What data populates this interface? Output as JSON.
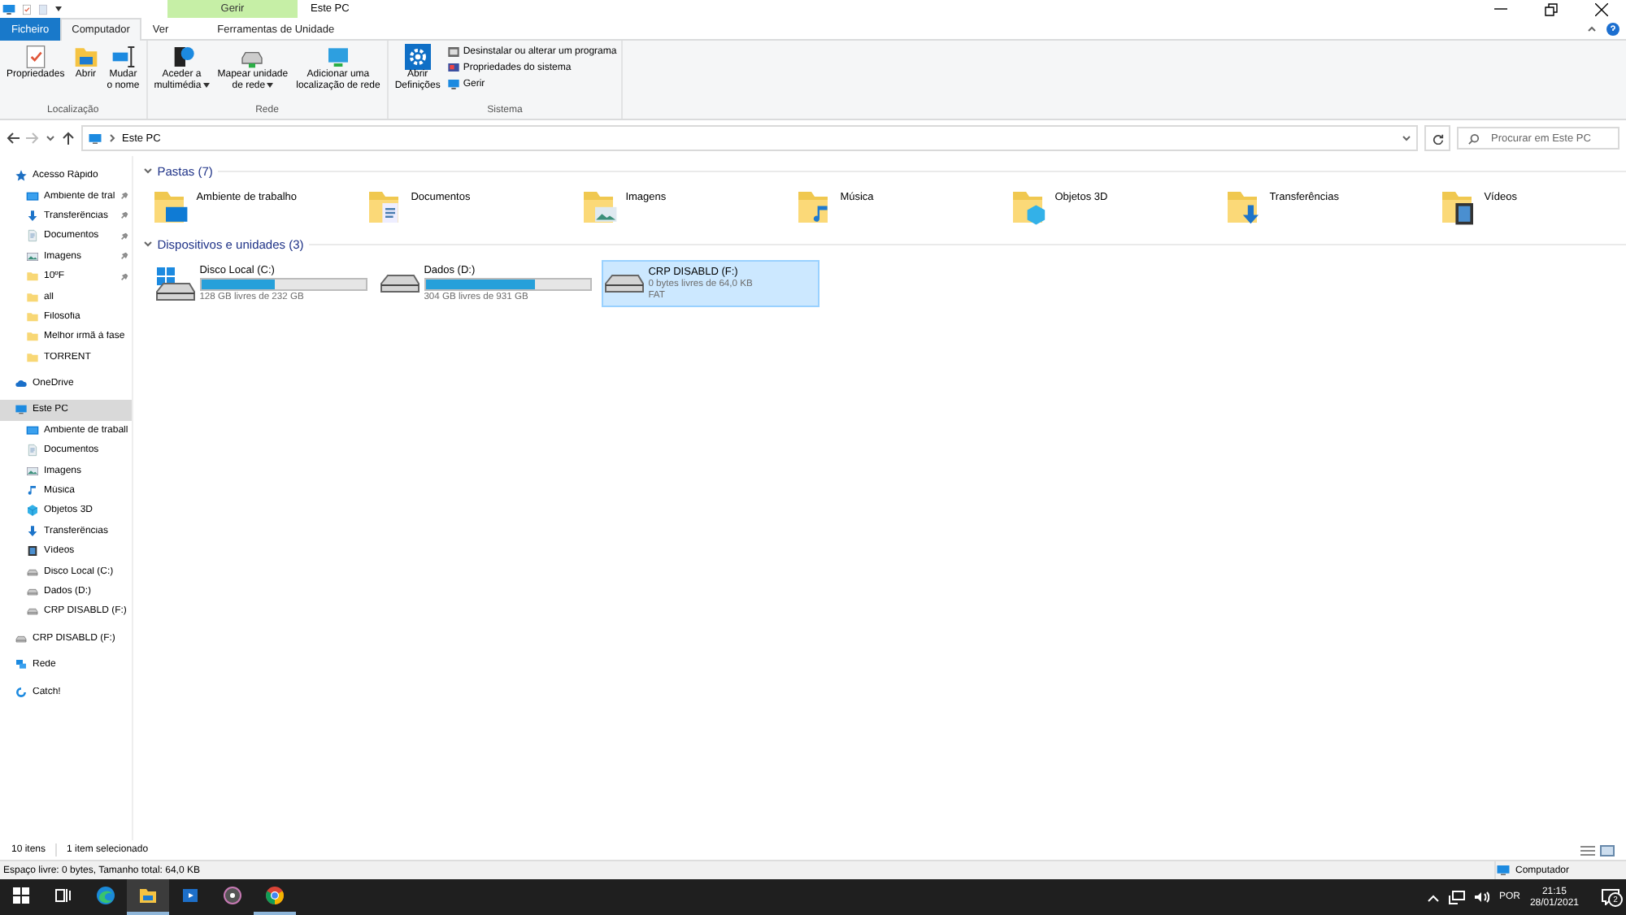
{
  "window": {
    "title": "Este PC",
    "context_header": "Gerir"
  },
  "ribbon": {
    "tabs": [
      {
        "label": "Ficheiro",
        "kind": "file",
        "selected": false
      },
      {
        "label": "Computador",
        "kind": "normal",
        "selected": true
      },
      {
        "label": "Ver",
        "kind": "normal",
        "selected": false
      },
      {
        "label": "Ferramentas de Unidade",
        "kind": "context",
        "selected": false
      }
    ],
    "groups": [
      {
        "label": "Localização",
        "buttons": [
          {
            "kind": "large",
            "lines": [
              "Propriedades"
            ],
            "dropdown": false
          },
          {
            "kind": "large",
            "lines": [
              "Abrir"
            ],
            "dropdown": false
          },
          {
            "kind": "large",
            "lines": [
              "Mudar",
              "o nome"
            ],
            "dropdown": false
          }
        ]
      },
      {
        "label": "Rede",
        "buttons": [
          {
            "kind": "large",
            "lines": [
              "Aceder a",
              "multimédia"
            ],
            "dropdown": true
          },
          {
            "kind": "large",
            "lines": [
              "Mapear unidade",
              "de rede"
            ],
            "dropdown": true
          },
          {
            "kind": "large",
            "lines": [
              "Adicionar uma",
              "localização de rede"
            ],
            "dropdown": false
          }
        ]
      },
      {
        "label": "Sistema",
        "buttons": [
          {
            "kind": "large",
            "lines": [
              "Abrir",
              "Definições"
            ],
            "dropdown": false
          },
          {
            "kind": "small",
            "lines": [
              "Desinstalar ou alterar um programa"
            ],
            "dropdown": false
          },
          {
            "kind": "small",
            "lines": [
              "Propriedades do sistema"
            ],
            "dropdown": false
          },
          {
            "kind": "small",
            "lines": [
              "Gerir"
            ],
            "dropdown": false
          }
        ]
      }
    ]
  },
  "address": {
    "path": "Este PC",
    "search_placeholder": "Procurar em Este PC"
  },
  "navigation": [
    {
      "label": "Acesso Rápido",
      "kind": "star",
      "selected": false,
      "pinned": false,
      "children": [
        {
          "label": "Ambiente de tral",
          "kind": "desktop",
          "selected": false,
          "pinned": true
        },
        {
          "label": "Transferências",
          "kind": "downloads",
          "selected": false,
          "pinned": true
        },
        {
          "label": "Documentos",
          "kind": "documents",
          "selected": false,
          "pinned": true
        },
        {
          "label": "Imagens",
          "kind": "pictures",
          "selected": false,
          "pinned": true
        },
        {
          "label": "10ºF",
          "kind": "folder",
          "selected": false,
          "pinned": true
        },
        {
          "label": "all",
          "kind": "folder",
          "selected": false,
          "pinned": false
        },
        {
          "label": "Filosofia",
          "kind": "folder",
          "selected": false,
          "pinned": false
        },
        {
          "label": "Melhor irmã à fase",
          "kind": "folder",
          "selected": false,
          "pinned": false
        },
        {
          "label": "TORRENT",
          "kind": "folder",
          "selected": false,
          "pinned": false
        }
      ]
    },
    {
      "label": "OneDrive",
      "kind": "cloud",
      "selected": false,
      "pinned": false
    },
    {
      "label": "Este PC",
      "kind": "pc",
      "selected": true,
      "pinned": false,
      "children": [
        {
          "label": "Ambiente de traball",
          "kind": "desktop",
          "selected": false,
          "pinned": false
        },
        {
          "label": "Documentos",
          "kind": "documents",
          "selected": false,
          "pinned": false
        },
        {
          "label": "Imagens",
          "kind": "pictures",
          "selected": false,
          "pinned": false
        },
        {
          "label": "Música",
          "kind": "music",
          "selected": false,
          "pinned": false
        },
        {
          "label": "Objetos 3D",
          "kind": "objects3d",
          "selected": false,
          "pinned": false
        },
        {
          "label": "Transferências",
          "kind": "downloads",
          "selected": false,
          "pinned": false
        },
        {
          "label": "Vídeos",
          "kind": "videos",
          "selected": false,
          "pinned": false
        },
        {
          "label": "Disco Local (C:)",
          "kind": "drive",
          "selected": false,
          "pinned": false
        },
        {
          "label": "Dados (D:)",
          "kind": "drive",
          "selected": false,
          "pinned": false
        },
        {
          "label": "CRP DISABLD (F:)",
          "kind": "drive",
          "selected": false,
          "pinned": false
        }
      ]
    },
    {
      "label": "CRP DISABLD (F:)",
      "kind": "drive",
      "selected": false,
      "pinned": false
    },
    {
      "label": "Rede",
      "kind": "network",
      "selected": false,
      "pinned": false
    },
    {
      "label": "Catch!",
      "kind": "catch",
      "selected": false,
      "pinned": false
    }
  ],
  "folders": {
    "heading": "Pastas (7)",
    "expanded": true,
    "items": [
      {
        "name": "Ambiente de trabalho",
        "kind": "desktop"
      },
      {
        "name": "Documentos",
        "kind": "documents"
      },
      {
        "name": "Imagens",
        "kind": "pictures"
      },
      {
        "name": "Música",
        "kind": "music"
      },
      {
        "name": "Objetos 3D",
        "kind": "objects3d"
      },
      {
        "name": "Transferências",
        "kind": "downloads"
      },
      {
        "name": "Vídeos",
        "kind": "videos"
      }
    ]
  },
  "drives": {
    "heading": "Dispositivos e unidades (3)",
    "expanded": true,
    "items": [
      {
        "name": "Disco Local (C:)",
        "kind": "system",
        "level": 0.45,
        "free": "128 GB livres de 232 GB",
        "selected": false
      },
      {
        "name": "Dados (D:)",
        "kind": "plain",
        "level": 0.67,
        "free": "304 GB livres de 931 GB",
        "selected": false
      },
      {
        "name": "CRP DISABLD (F:)",
        "kind": "plain",
        "free": "0 bytes livres de 64,0 KB",
        "filesystem": "FAT",
        "selected": true
      }
    ]
  },
  "status_bar": {
    "count": "10 itens",
    "selection": "1 item selecionado"
  },
  "details_bar": {
    "text": "Espaço livre: 0 bytes, Tamanho total: 64,0 KB",
    "location": "Computador"
  },
  "taskbar": {
    "apps": [
      {
        "active": false
      },
      {
        "active": true
      },
      {
        "active": false
      },
      {
        "active": false
      },
      {
        "active": true
      }
    ],
    "language": "POR",
    "time": "21:15",
    "date": "28/01/2021",
    "notifications": "2"
  }
}
